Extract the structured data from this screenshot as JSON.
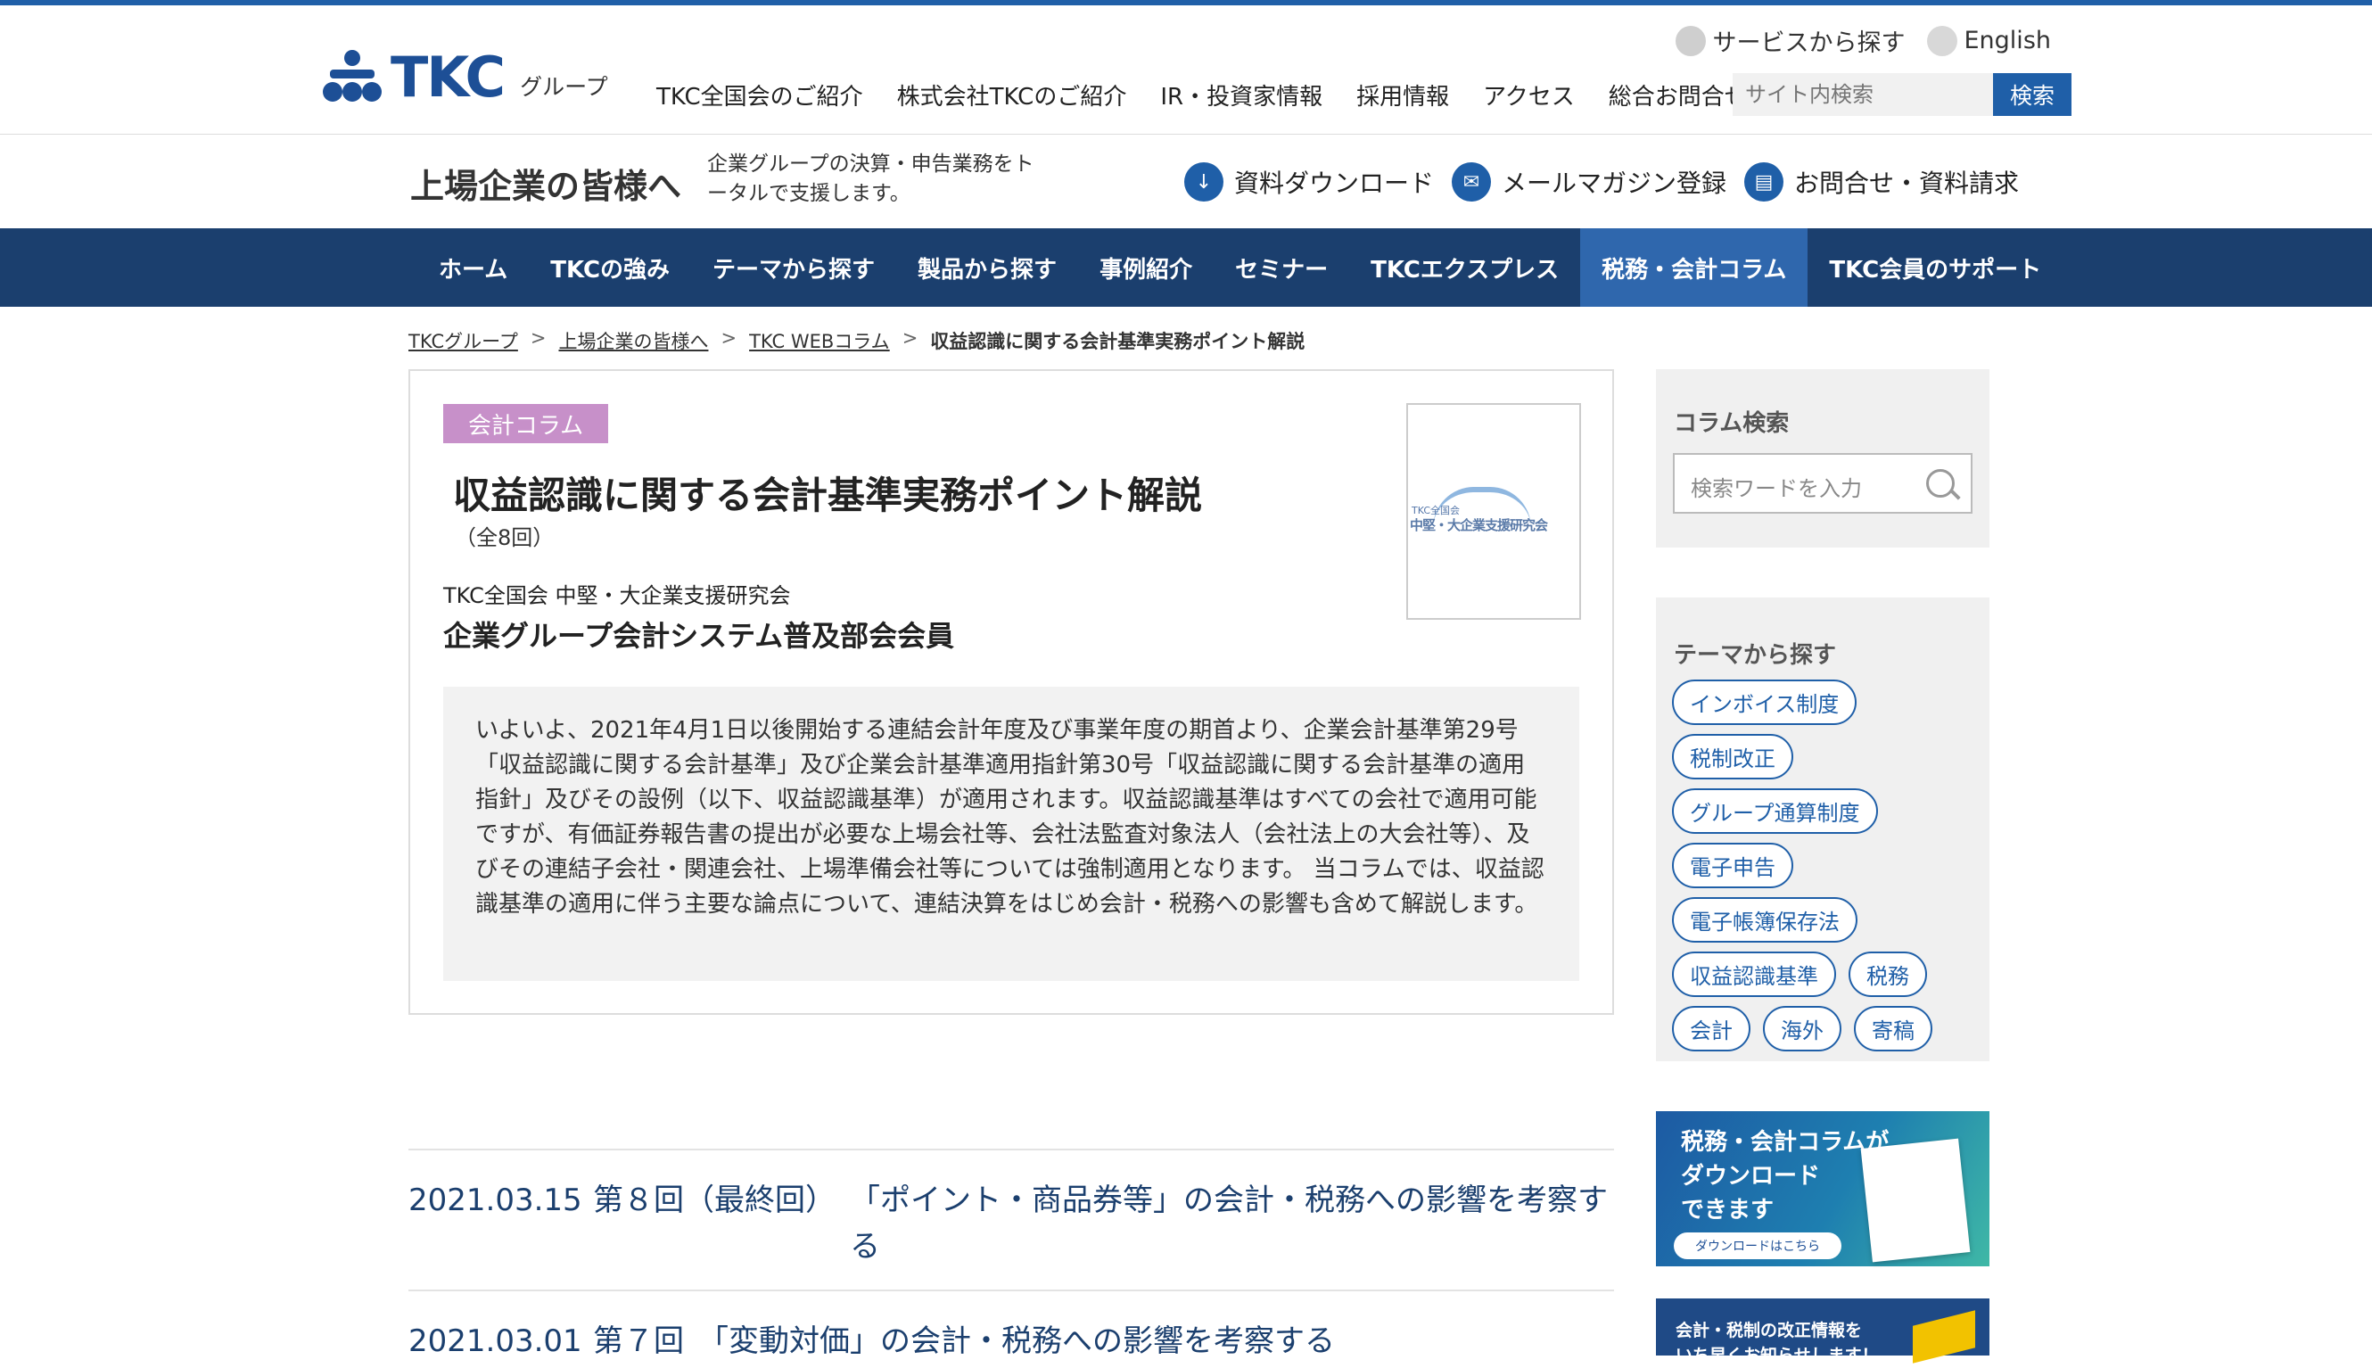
{
  "util": {
    "service_label": "サービスから探す",
    "english_label": "English"
  },
  "logo": {
    "word": "TKC",
    "group": "グループ"
  },
  "global_nav": [
    "TKC全国会のご紹介",
    "株式会社TKCのご紹介",
    "IR・投資家情報",
    "採用情報",
    "アクセス",
    "総合お問合せ"
  ],
  "search": {
    "placeholder": "サイト内検索",
    "button": "検索"
  },
  "sub_header": {
    "title": "上場企業の皆様へ",
    "desc": "企業グループの決算・申告業務をトータルで支援します。",
    "actions": [
      "資料ダウンロード",
      "メールマガジン登録",
      "お問合せ・資料請求"
    ]
  },
  "main_nav": [
    "ホーム",
    "TKCの強み",
    "テーマから探す",
    "製品から探す",
    "事例紹介",
    "セミナー",
    "TKCエクスプレス",
    "税務・会計コラム",
    "TKC会員のサポート"
  ],
  "main_nav_active": "税務・会計コラム",
  "breadcrumb": [
    "TKCグループ",
    "上場企業の皆様へ",
    "TKC WEBコラム",
    "収益認識に関する会計基準実務ポイント解説"
  ],
  "article": {
    "category": "会計コラム",
    "title": "収益認識に関する会計基準実務ポイント解説",
    "count": "（全8回）",
    "org": "TKC全国会 中堅・大企業支援研究会",
    "org2": "企業グループ会計システム普及部会会員",
    "thumb_small": "TKC全国会",
    "thumb_main": "中堅・大企業支援研究会",
    "intro": "いよいよ、2021年4月1日以後開始する連結会計年度及び事業年度の期首より、企業会計基準第29号「収益認識に関する会計基準」及び企業会計基準適用指針第30号「収益認識に関する会計基準の適用指針」及びその設例（以下、収益認識基準）が適用されます。収益認識基準はすべての会社で適用可能ですが、有価証券報告書の提出が必要な上場会社等、会社法監査対象法人（会社法上の大会社等）、及びその連結子会社・関連会社、上場準備会社等については強制適用となります。 当コラムでは、収益認識基準の適用に伴う主要な論点について、連結決算をはじめ会計・税務への影響も含めて解説します。"
  },
  "columns": [
    {
      "date": "2021.03.15",
      "no": "第８回（最終回）",
      "title": "「ポイント・商品券等」の会計・税務への影響を考察する"
    },
    {
      "date": "2021.03.01",
      "no": "第７回",
      "title": "「変動対価」の会計・税務への影響を考察する"
    }
  ],
  "sidebar": {
    "search_title": "コラム検索",
    "search_placeholder": "検索ワードを入力",
    "theme_title": "テーマから探す",
    "tags": [
      "インボイス制度",
      "税制改正",
      "グループ通算制度",
      "電子申告",
      "電子帳簿保存法",
      "収益認識基準",
      "税務",
      "会計",
      "海外",
      "寄稿"
    ],
    "banner1": {
      "line1": "税務・会計コラムが",
      "line2": "ダウンロード",
      "line3": "できます",
      "button": "ダウンロードはこちら"
    },
    "banner2": {
      "line1": "会計・税制の改正情報を",
      "line2": "いち早くお知らせします！"
    }
  },
  "colors": {
    "brand": "#1f5fa8",
    "nav_bg": "#1b3f6e",
    "nav_active": "#2f67ad",
    "category": "#c790c9"
  }
}
